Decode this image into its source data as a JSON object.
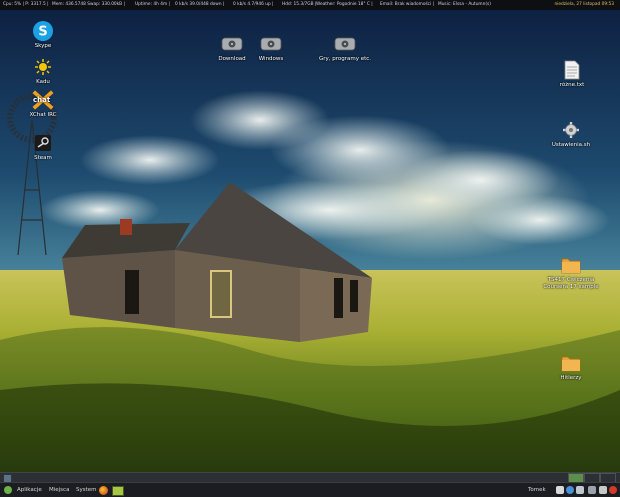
{
  "topbar": {
    "segments": [
      "Cpu: 5% | P: 3317.5 |",
      "Mem: 436.5748 Swap: 330.00kB |",
      "Uptime: 4h 4m |",
      "0 kb/s 39.0/448 down |",
      "0 kb/s 4.7/946 up |",
      "Hdd: 15.3/7GB |",
      "Weather: Pogodnie 18° C |",
      "Email: Brak wiadomości |",
      "Music: Elssa - Autumn(s)"
    ],
    "clock": "niedziela, 27 listopad 09:53"
  },
  "desktop": {
    "left_icons": [
      {
        "name": "skype-icon",
        "label": "Skype"
      },
      {
        "name": "kadu-icon",
        "label": "Kadu"
      },
      {
        "name": "xchat-icon",
        "label": "XChat IRC"
      },
      {
        "name": "steam-icon",
        "label": "Steam"
      }
    ],
    "drives": [
      {
        "name": "drive-download-icon",
        "label": "Download"
      },
      {
        "name": "drive-windows-icon",
        "label": "Windows"
      },
      {
        "name": "drive-games-icon",
        "label": "Gry, programy etc."
      }
    ],
    "right_icons": [
      {
        "name": "text-file-icon",
        "label": "różne.txt"
      },
      {
        "name": "settings-icon",
        "label": "Ustawienia.sh"
      },
      {
        "name": "folder-course-icon",
        "label": "TS417 Cwiczenia\nCoursera 17 sample"
      },
      {
        "name": "folder-hitlerzy-icon",
        "label": "Hitlerzy"
      }
    ],
    "xchat_badge": "chat"
  },
  "taskbar": {
    "menus": [
      "Aplikacje",
      "Miejsca",
      "System"
    ],
    "user": "Tomek"
  },
  "colors": {
    "topbar_bg": "#0d0f12",
    "clock": "#e3c26a",
    "taskbar_bg": "#1b1d20"
  }
}
